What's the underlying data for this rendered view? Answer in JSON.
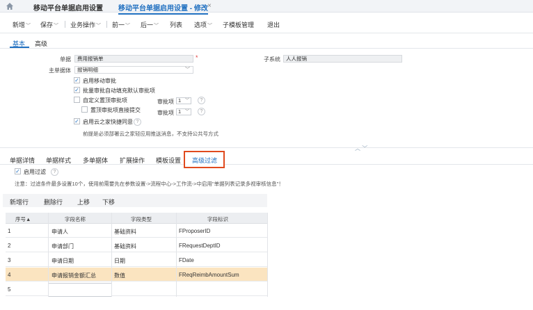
{
  "tabs": {
    "tab1": "移动平台单据启用设置",
    "tab2": "移动平台单据启用设置 - 修改",
    "close": "×"
  },
  "toolbar": {
    "add": "新增",
    "save": "保存",
    "business": "业务操作",
    "prev": "前一",
    "next": "后一",
    "list": "列表",
    "options": "选项",
    "submodel": "子模板管理",
    "exit": "退出"
  },
  "subtabs": {
    "basic": "基本",
    "advanced": "高级"
  },
  "form": {
    "bill_label": "单据",
    "bill_value": "费用报销单",
    "required": "*",
    "subsystem_label": "子系统",
    "subsystem_value": "人人报销",
    "mainentity_label": "主单据体",
    "mainentity_value": "报销明细",
    "cb_mobile_approve": "启用移动审批",
    "cb_batch_approve": "批量审批自动填充默认审批项",
    "cb_custom_approve": "自定义置顶审批项",
    "approve_item_label": "审批项",
    "approve_item_value": "1",
    "cb_top_submit": "置顶审批项直接提交",
    "approve_item2_label": "审批项",
    "approve_item2_value": "1",
    "cb_cloud_agree": "启用云之家快捷同意",
    "help": "?",
    "note": "前提是必须部署云之家轻应用推送消息，不支持公共号方式"
  },
  "lower_tabs": {
    "t1": "单据详情",
    "t2": "单据样式",
    "t3": "多单据体",
    "t4": "扩展操作",
    "t5": "模板设置",
    "t6": "高级过滤"
  },
  "filter": {
    "enable_label": "启用过滤",
    "notice": "注意：过滤条件最多设置10个，使用前需要先在参数设置->流程中心->工作流->中启用\"单据列表记录多视审核信息\"！"
  },
  "grid_toolbar": {
    "add_row": "新增行",
    "del_row": "删除行",
    "up": "上移",
    "down": "下移"
  },
  "table": {
    "headers": [
      "序号▲",
      "字段名称",
      "字段类型",
      "字段标识"
    ],
    "rows": [
      [
        "1",
        "申请人",
        "基础资料",
        "FProposerID"
      ],
      [
        "2",
        "申请部门",
        "基础资料",
        "FRequestDeptID"
      ],
      [
        "3",
        "申请日期",
        "日期",
        "FDate"
      ],
      [
        "4",
        "申请报销金额汇总",
        "数值",
        "FReqReimbAmountSum"
      ],
      [
        "5",
        "",
        "",
        ""
      ]
    ],
    "selected_row": 4,
    "selected_color": "#fbe4c0"
  },
  "accent_color": "#1f6fc0",
  "highlight_color": "#e04a1e"
}
